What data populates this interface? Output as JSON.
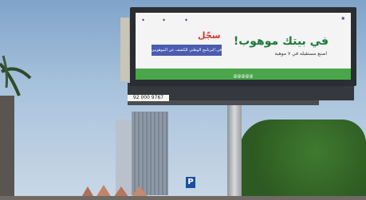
{
  "billboard": {
    "headline": "في بيتك موهوب!",
    "subheadline": "اصنع مستقبله في ٧ موهبة",
    "call_to_action": "سجّل",
    "banner_text": "في البرنامج الوطني للكشف عن الموهوبين",
    "footer": "@@@@@"
  },
  "signage": {
    "phone_number": "92 000 9767",
    "parking_letter": "P"
  }
}
